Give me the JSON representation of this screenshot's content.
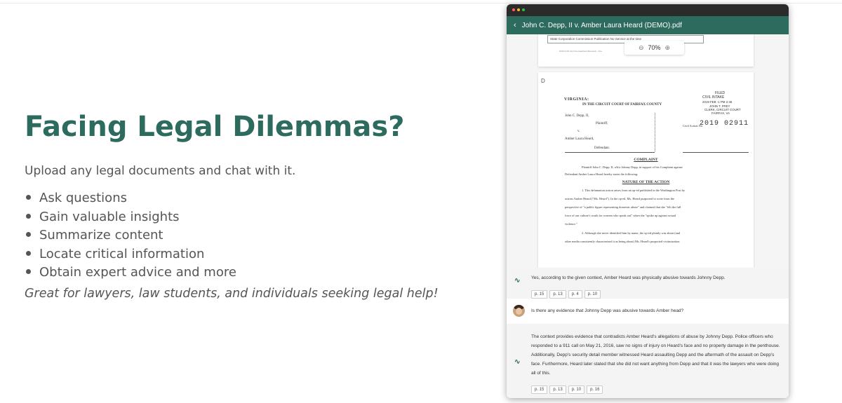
{
  "hero": {
    "title": "Facing Legal Dilemmas?",
    "subtitle": "Upload any legal documents and chat with it.",
    "bullets": [
      "Ask questions",
      "Gain valuable insights",
      "Summarize content",
      "Locate critical information",
      "Obtain expert advice and more"
    ],
    "tagline": "Great for lawyers, law students, and individuals seeking legal help!"
  },
  "window": {
    "title": "John C. Depp, II v. Amber Laura Heard (DEMO).pdf",
    "zoom": "70%"
  },
  "doc": {
    "page1_table": "State Corporation Commission   Publication   No Service at the time",
    "page1_footer": "DOR D-06 Civil Overwatched (Revised) - One",
    "page2_mark": "D",
    "filed1": "FILED",
    "filed2": "CIVIL INTAKE",
    "filed3": "2019 FEB -1 PM 2:45",
    "clerk1": "JOHN T. FREY",
    "clerk2": "CLERK, CIRCUIT COURT",
    "clerk3": "FAIRFAX, VA",
    "state": "VIRGINIA:",
    "court": "IN THE CIRCUIT COURT OF FAIRFAX COUNTY",
    "plaintiff_name": "John C. Depp, II,",
    "plaintiff_label": "Plaintiff,",
    "versus": "v.",
    "case_label": "Civil Action No.",
    "case_number": "2019 02911",
    "defendant_name": "Amber Laura Heard,",
    "defendant_label": "Defendant.",
    "heading1": "COMPLAINT",
    "intro1": "Plaintiff John C. Depp, II, a/k/a Johnny Depp, in support of his Complaint against",
    "intro2": "Defendant Amber Laura Heard hereby states the following:",
    "heading2": "NATURE OF THE ACTION",
    "para1_1": "1.       This defamation action arises from an op-ed published in the Washington Post by",
    "para1_2": "actress Amber Heard (\"Ms. Heard\"). In the op-ed, Ms. Heard purported to write from the",
    "para1_3": "perspective of \"a public figure representing domestic abuse\" and claimed that she \"felt the full",
    "para1_4": "force of our culture's wrath for women who speak out\" when she \"spoke up against sexual",
    "para1_5": "violence.\"",
    "para2_1": "2.       Although she never identified him by name, the op-ed plainly was about (and",
    "para2_2": "other media consistently characterized it as being about) Ms. Heard's purported victimization"
  },
  "chat": {
    "ai1_text": "Yes, according to the given context, Amber Heard was physically abusive towards Johnny Depp.",
    "ai1_pages": [
      "p. 15",
      "p. 13",
      "p. 4",
      "p. 10"
    ],
    "user1_text": "Is there any evidence that Johnny Depp was abusive towards Amber head?",
    "ai2_text": "The context provides evidence that contradicts Amber Heard's allegations of abuse by Johnny Depp. Police officers who responded to a 911 call on May 21, 2016, saw no signs of injury on Heard's face and no property damage in the penthouse. Additionally, Depp's security detail member witnessed Heard assaulting Depp and the aftermath of the assault on Depp's face. Furthermore, Heard later stated that she did not want anything from Depp and that it was the lawyers who were doing all of this.",
    "ai2_pages": [
      "p. 15",
      "p. 13",
      "p. 10",
      "p. 16"
    ]
  },
  "colors": {
    "accent": "#2e6b5f",
    "titlebar": "#2b2b2b"
  },
  "icons": {
    "back": "chevron-left-icon",
    "zoom_out": "zoom-out-icon",
    "zoom_in": "zoom-in-icon",
    "assistant": "assistant-icon",
    "user": "user-avatar"
  }
}
